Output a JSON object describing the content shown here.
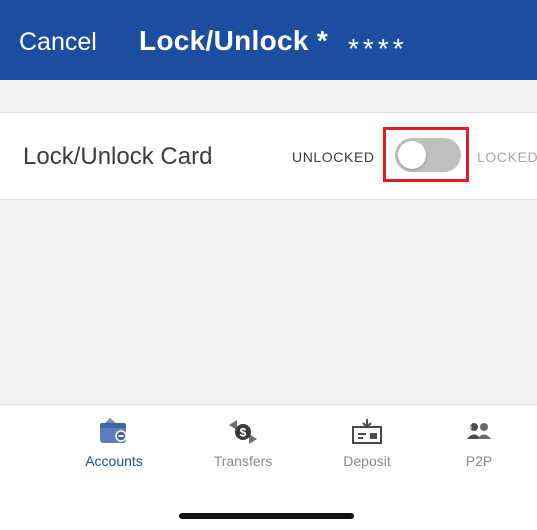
{
  "navbar": {
    "cancel_label": "Cancel",
    "title": "Lock/Unlock *",
    "masked_number": "****"
  },
  "lock_row": {
    "label": "Lock/Unlock Card",
    "state_unlocked": "UNLOCKED",
    "state_locked": "LOCKED",
    "toggle_on": false
  },
  "tabbar": {
    "items": [
      {
        "label": "Accounts",
        "icon": "wallet-icon",
        "active": true
      },
      {
        "label": "Transfers",
        "icon": "transfer-dollar-icon",
        "active": false
      },
      {
        "label": "Deposit",
        "icon": "deposit-check-icon",
        "active": false
      },
      {
        "label": "P2P",
        "icon": "p2p-people-icon",
        "active": false
      }
    ]
  },
  "colors": {
    "brand": "#1b4da0",
    "highlight": "#e01e26",
    "toggle_off": "#bfbfc2",
    "inactive_tab": "#8a8a8e"
  }
}
